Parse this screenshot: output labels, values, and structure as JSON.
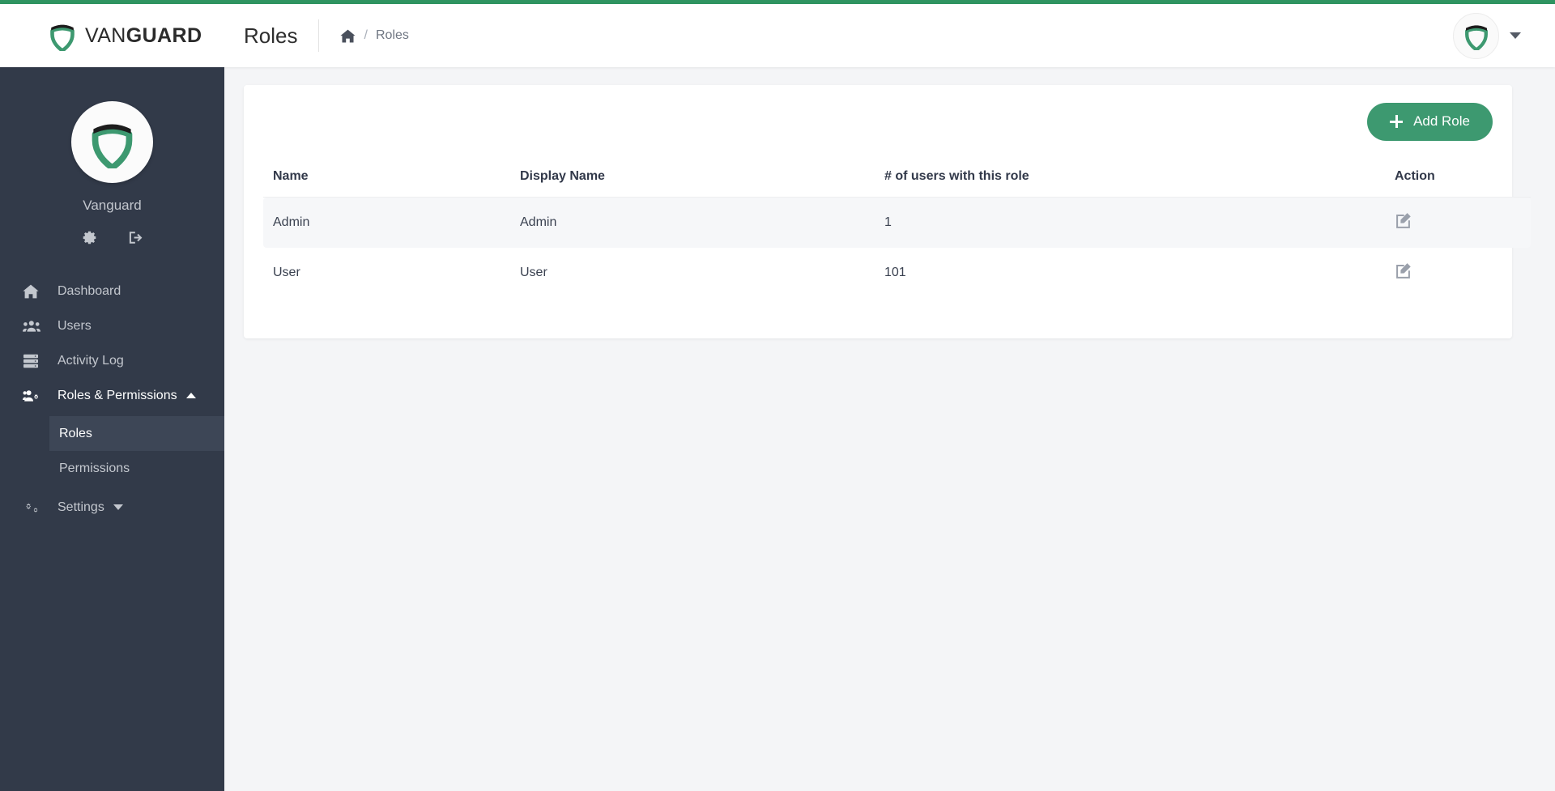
{
  "theme": {
    "accent_green": "#2f9461",
    "button_green": "#3d9970",
    "sidebar_bg": "#323a49",
    "sidebar_active_bg": "#3d4656",
    "page_bg": "#f4f5f7",
    "text_dark": "#32394a",
    "text_muted": "#6f7682"
  },
  "topbar": {
    "brand_prefix": "VAN",
    "brand_suffix": "GUARD",
    "brand_logo_icon": "vanguard-shield-icon",
    "page_title": "Roles",
    "breadcrumb": {
      "home_icon": "home-icon",
      "separator": "/",
      "current": "Roles"
    },
    "user_menu": {
      "avatar_icon": "vanguard-shield-icon",
      "caret_icon": "caret-down-icon"
    }
  },
  "sidebar": {
    "profile": {
      "avatar_icon": "vanguard-shield-icon",
      "username": "Vanguard",
      "settings_icon": "gear-icon",
      "logout_icon": "logout-icon"
    },
    "items": [
      {
        "label": "Dashboard",
        "icon": "home-icon",
        "active": false,
        "expandable": false
      },
      {
        "label": "Users",
        "icon": "users-icon",
        "active": false,
        "expandable": false
      },
      {
        "label": "Activity Log",
        "icon": "server-icon",
        "active": false,
        "expandable": false
      },
      {
        "label": "Roles & Permissions",
        "icon": "users-cog-icon",
        "active": true,
        "expandable": true,
        "caret": "caret-up-icon"
      },
      {
        "label": "Settings",
        "icon": "cogs-icon",
        "active": false,
        "expandable": true,
        "caret": "caret-down-icon"
      }
    ],
    "submenu": [
      {
        "label": "Roles",
        "active": true
      },
      {
        "label": "Permissions",
        "active": false
      }
    ]
  },
  "main": {
    "add_button": {
      "label": "Add Role",
      "icon": "plus-icon"
    },
    "table": {
      "columns": [
        "Name",
        "Display Name",
        "# of users with this role",
        "Action"
      ],
      "rows": [
        {
          "name": "Admin",
          "display_name": "Admin",
          "user_count": "1",
          "action_icon": "edit-icon"
        },
        {
          "name": "User",
          "display_name": "User",
          "user_count": "101",
          "action_icon": "edit-icon"
        }
      ]
    }
  }
}
